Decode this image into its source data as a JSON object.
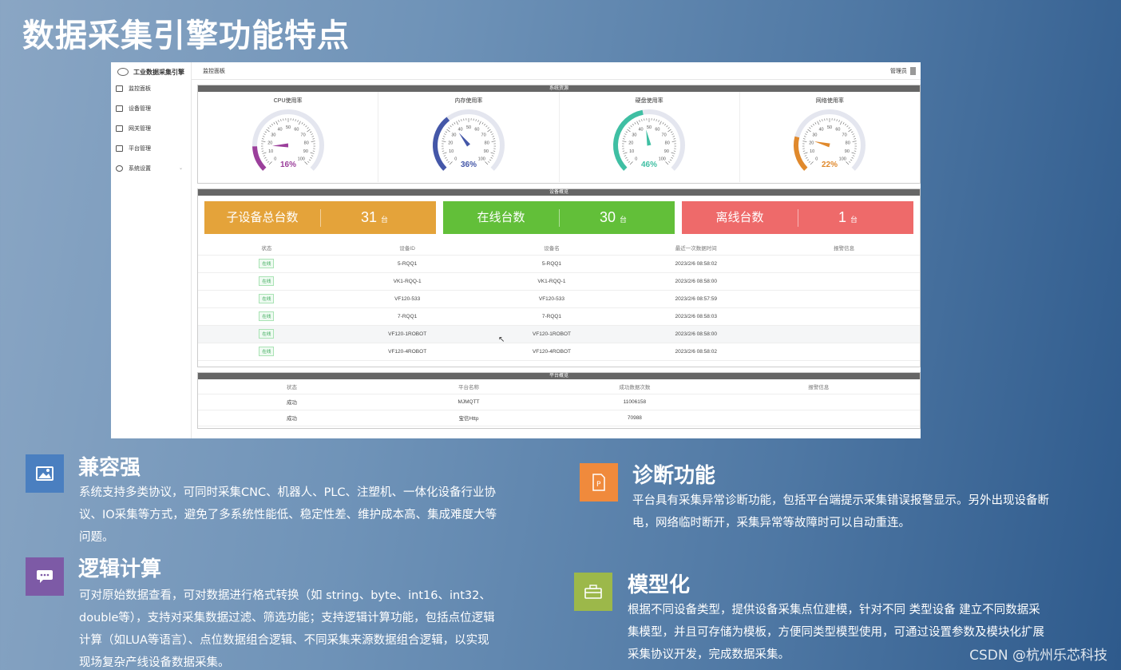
{
  "slide_title": "数据采集引擎功能特点",
  "app": {
    "brand": "工业数据采集引擎",
    "nav": [
      {
        "label": "监控面板",
        "icon": "monitor-icon"
      },
      {
        "label": "设备管理",
        "icon": "device-icon"
      },
      {
        "label": "网关管理",
        "icon": "gateway-icon"
      },
      {
        "label": "平台管理",
        "icon": "platform-icon"
      },
      {
        "label": "系统设置",
        "icon": "gear-icon"
      }
    ],
    "breadcrumb": "监控面板",
    "user": "管理员",
    "resources_title": "系统资源",
    "gauges": [
      {
        "label": "CPU使用率",
        "value": 16,
        "text": "16%",
        "color": "#9b3f9b"
      },
      {
        "label": "内存使用率",
        "value": 36,
        "text": "36%",
        "color": "#4457a8"
      },
      {
        "label": "硬盘使用率",
        "value": 46,
        "text": "46%",
        "color": "#3fbfa3"
      },
      {
        "label": "网络使用率",
        "value": 22,
        "text": "22%",
        "color": "#e0892c"
      }
    ],
    "gauge_ticks": [
      "0",
      "10",
      "20",
      "30",
      "40",
      "50",
      "60",
      "70",
      "80",
      "90",
      "100"
    ],
    "overview_title": "设备概览",
    "cards": [
      {
        "label": "子设备总台数",
        "value": "31",
        "unit": "台",
        "color": "#e4a33a"
      },
      {
        "label": "在线台数",
        "value": "30",
        "unit": "台",
        "color": "#62bf39"
      },
      {
        "label": "离线台数",
        "value": "1",
        "unit": "台",
        "color": "#ee6a6a"
      }
    ],
    "device_columns": [
      "状态",
      "设备ID",
      "设备名",
      "最近一次数据时间",
      "报警信息"
    ],
    "devices": [
      {
        "status": "在线",
        "id": "5-RQQ1",
        "name": "5-RQQ1",
        "time": "2023/2/6 08:58:02",
        "alarm": ""
      },
      {
        "status": "在线",
        "id": "VK1-RQQ-1",
        "name": "VK1-RQQ-1",
        "time": "2023/2/6 08:58:00",
        "alarm": ""
      },
      {
        "status": "在线",
        "id": "VF120-533",
        "name": "VF120-533",
        "time": "2023/2/6 08:57:59",
        "alarm": ""
      },
      {
        "status": "在线",
        "id": "7-RQQ1",
        "name": "7-RQQ1",
        "time": "2023/2/6 08:58:03",
        "alarm": ""
      },
      {
        "status": "在线",
        "id": "VF120-1ROBOT",
        "name": "VF120-1ROBOT",
        "time": "2023/2/6 08:58:00",
        "alarm": ""
      },
      {
        "status": "在线",
        "id": "VF120-4ROBOT",
        "name": "VF120-4ROBOT",
        "time": "2023/2/6 08:58:02",
        "alarm": ""
      }
    ],
    "platform_title": "平台概览",
    "platform_columns": [
      "状态",
      "平台名称",
      "成功数据次数",
      "报警信息"
    ],
    "platforms": [
      {
        "status": "成功",
        "name": "MJMQTT",
        "count": "11006158",
        "alarm": ""
      },
      {
        "status": "成功",
        "name": "宝信Http",
        "count": "70988",
        "alarm": ""
      }
    ]
  },
  "features": [
    {
      "title": "兼容强",
      "icon": "image-icon",
      "color": "#4a7fc0",
      "lines": [
        "系统支持多类协议，可同时采集CNC、机器人、PLC、注塑机、一体化设备行业协",
        "议、IO采集等方式，避免了多系统性能低、稳定性差、维护成本高、集成难度大等",
        "问题。"
      ]
    },
    {
      "title": "诊断功能",
      "icon": "document-icon",
      "color": "#f08a3c",
      "lines": [
        "平台具有采集异常诊断功能，包括平台端提示采集错误报警显示。另外出现设备断",
        "电，网络临时断开，采集异常等故障时可以自动重连。"
      ]
    },
    {
      "title": "逻辑计算",
      "icon": "chat-icon",
      "color": "#7d5aa6",
      "lines": [
        "可对原始数据查看，可对数据进行格式转换（如 string、byte、int16、int32、",
        "double等），支持对采集数据过滤、筛选功能；支持逻辑计算功能，包括点位逻辑",
        "计算（如LUA等语言）、点位数据组合逻辑、不同采集来源数据组合逻辑，以实现",
        "现场复杂产线设备数据采集。"
      ]
    },
    {
      "title": "模型化",
      "icon": "toolbox-icon",
      "color": "#9cb84a",
      "lines": [
        "根据不同设备类型，提供设备采集点位建模，针对不同 类型设备  建立不同数据采",
        "集模型，并且可存储为模板，方便同类型模型使用，可通过设置参数及模块化扩展",
        "采集协议开发，完成数据采集。"
      ]
    }
  ],
  "watermark": "CSDN @杭州乐芯科技"
}
